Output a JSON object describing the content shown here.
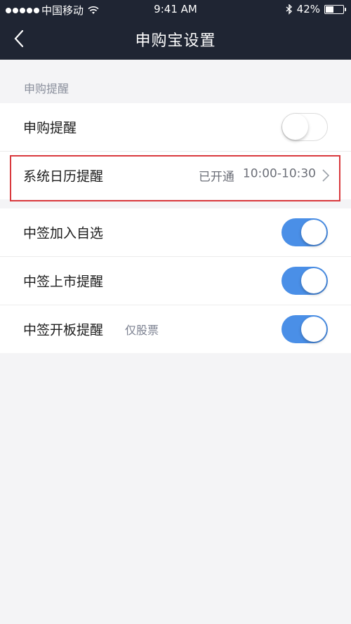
{
  "status_bar": {
    "carrier": "中国移动",
    "time": "9:41 AM",
    "battery": "42%",
    "battery_level": 0.42
  },
  "nav": {
    "title": "申购宝设置",
    "back_icon": "chevron-left-icon"
  },
  "section1": {
    "header": "申购提醒",
    "rows": [
      {
        "label": "申购提醒",
        "toggle": false
      },
      {
        "label": "系统日历提醒",
        "status": "已开通",
        "time_range": "10:00-10:30"
      }
    ]
  },
  "section2": {
    "rows": [
      {
        "label": "中签加入自选",
        "toggle": true
      },
      {
        "label": "中签上市提醒",
        "toggle": true
      },
      {
        "label": "中签开板提醒",
        "note": "仅股票",
        "toggle": true
      }
    ]
  },
  "colors": {
    "nav_bg": "#1f2533",
    "toggle_on": "#4a8fe7",
    "highlight": "#d9393d"
  }
}
